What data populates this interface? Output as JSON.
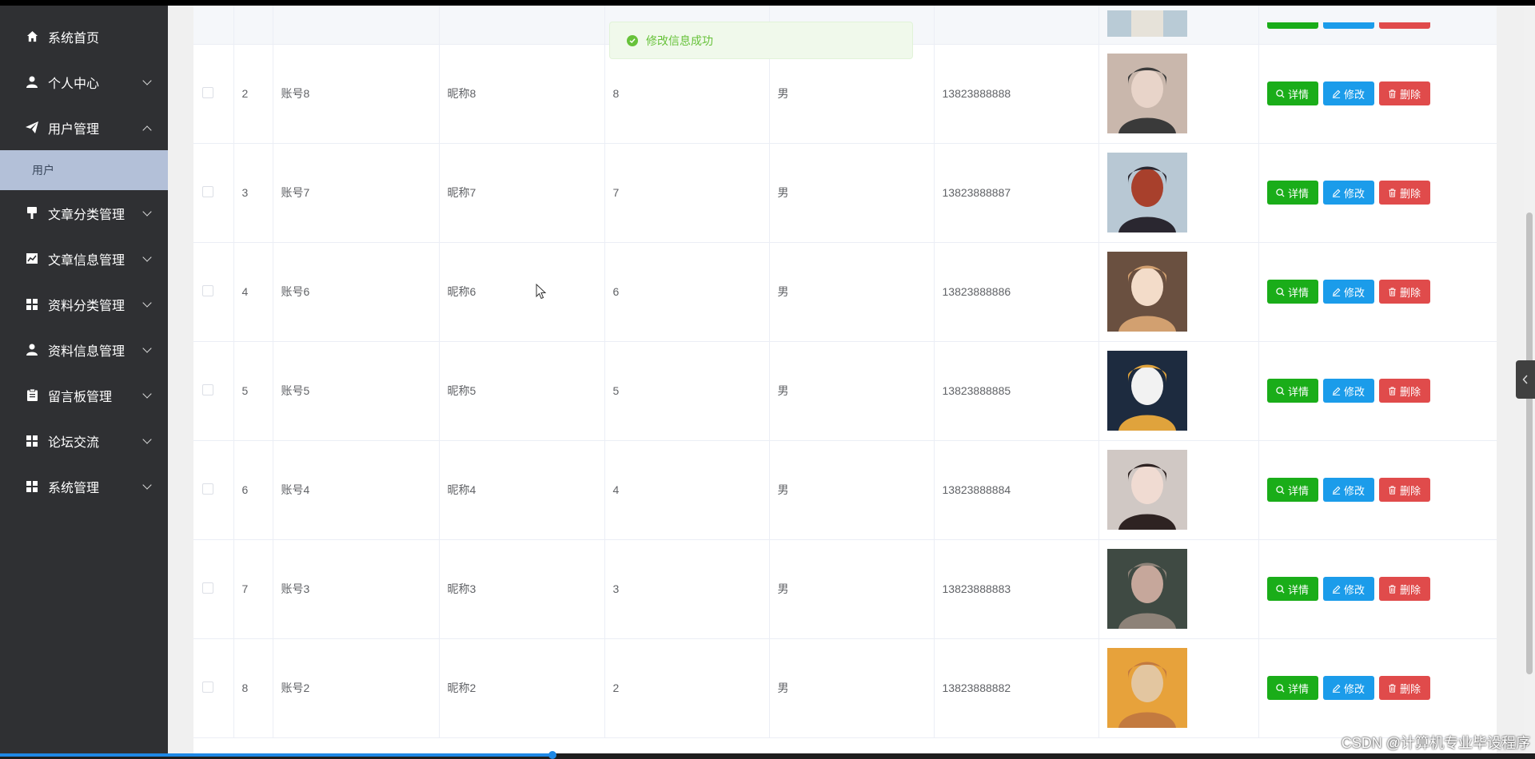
{
  "sidebar": {
    "items": [
      {
        "label": "系统首页",
        "icon": "home-icon",
        "expandable": false
      },
      {
        "label": "个人中心",
        "icon": "user-icon",
        "expandable": true
      },
      {
        "label": "用户管理",
        "icon": "paper-plane-icon",
        "expandable": true,
        "expanded": true,
        "children": [
          {
            "label": "用户",
            "active": true
          }
        ]
      },
      {
        "label": "文章分类管理",
        "icon": "brush-icon",
        "expandable": true
      },
      {
        "label": "文章信息管理",
        "icon": "chart-icon",
        "expandable": true
      },
      {
        "label": "资料分类管理",
        "icon": "grid-icon",
        "expandable": true
      },
      {
        "label": "资料信息管理",
        "icon": "user-icon",
        "expandable": true
      },
      {
        "label": "留言板管理",
        "icon": "clipboard-icon",
        "expandable": true
      },
      {
        "label": "论坛交流",
        "icon": "grid-icon",
        "expandable": true
      },
      {
        "label": "系统管理",
        "icon": "grid-icon",
        "expandable": true
      }
    ]
  },
  "toast": {
    "message": "修改信息成功",
    "type": "success"
  },
  "table": {
    "actions": {
      "detail": "详情",
      "edit": "修改",
      "delete": "删除"
    },
    "rows": [
      {
        "index": "2",
        "account": "账号8",
        "nickname": "昵称8",
        "age": "8",
        "gender": "男",
        "phone": "13823888888",
        "photo_colors": [
          "#c9b7ac",
          "#3a3a3a",
          "#e8d4c9"
        ]
      },
      {
        "index": "3",
        "account": "账号7",
        "nickname": "昵称7",
        "age": "7",
        "gender": "男",
        "phone": "13823888887",
        "photo_colors": [
          "#b8c8d4",
          "#2a2730",
          "#a8402c"
        ]
      },
      {
        "index": "4",
        "account": "账号6",
        "nickname": "昵称6",
        "age": "6",
        "gender": "男",
        "phone": "13823888886",
        "photo_colors": [
          "#6a5040",
          "#d2a070",
          "#f3dcc9"
        ]
      },
      {
        "index": "5",
        "account": "账号5",
        "nickname": "昵称5",
        "age": "5",
        "gender": "男",
        "phone": "13823888885",
        "photo_colors": [
          "#1d2b3f",
          "#e0a33c",
          "#f2f2f2"
        ]
      },
      {
        "index": "6",
        "account": "账号4",
        "nickname": "昵称4",
        "age": "4",
        "gender": "男",
        "phone": "13823888884",
        "photo_colors": [
          "#d0c8c4",
          "#2e2322",
          "#f0dbd2"
        ]
      },
      {
        "index": "7",
        "account": "账号3",
        "nickname": "昵称3",
        "age": "3",
        "gender": "男",
        "phone": "13823888883",
        "photo_colors": [
          "#3f4a43",
          "#8d8278",
          "#c6a79b"
        ]
      },
      {
        "index": "8",
        "account": "账号2",
        "nickname": "昵称2",
        "age": "2",
        "gender": "男",
        "phone": "13823888882",
        "photo_colors": [
          "#e7a23b",
          "#c37a3f",
          "#e3c6a0"
        ]
      }
    ]
  },
  "watermark": "CSDN @计算机专业毕设程序",
  "colors": {
    "sidebar_bg": "#2f3033",
    "active_submenu": "#b3c0d8",
    "detail_btn": "#1aad19",
    "edit_btn": "#1b9cea",
    "delete_btn": "#e04b4b",
    "success": "#67c23a"
  }
}
